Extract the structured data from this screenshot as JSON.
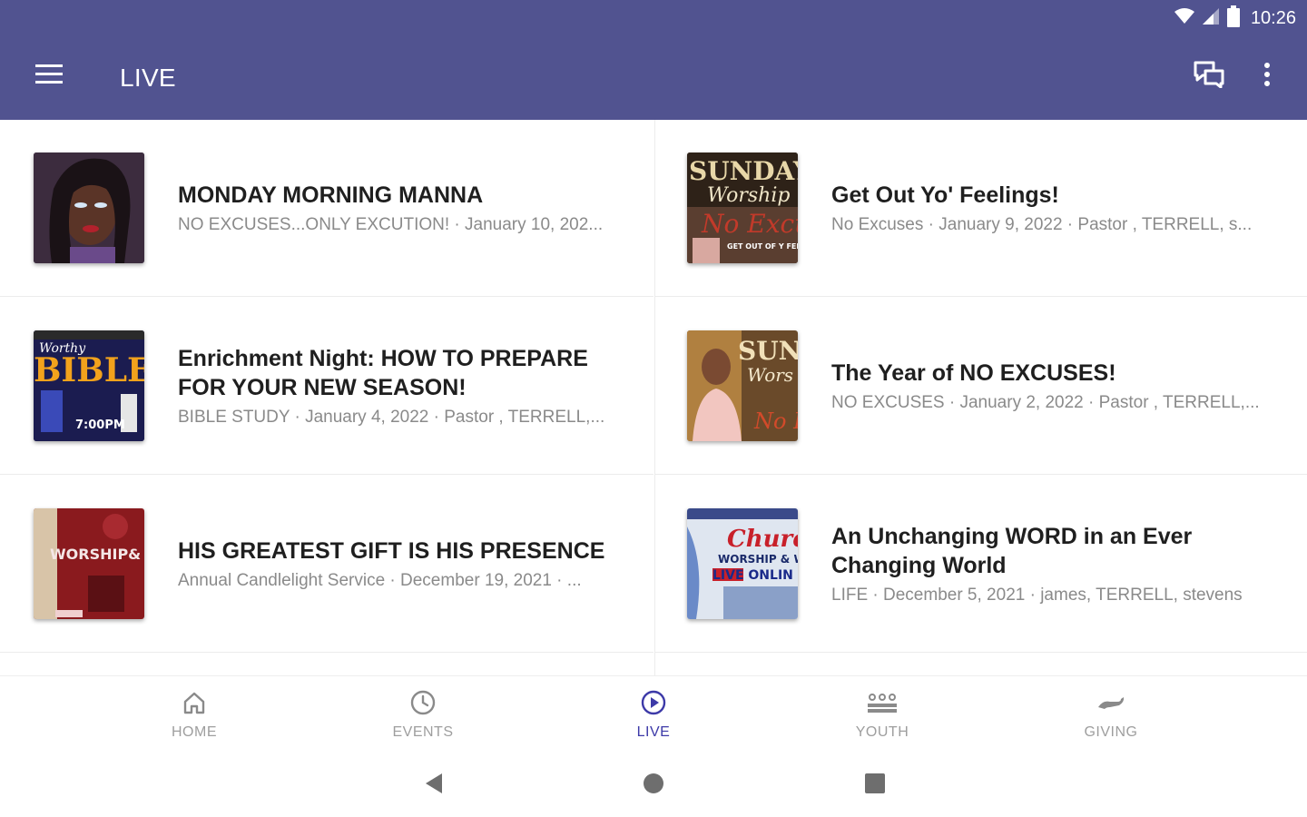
{
  "status_bar": {
    "time": "10:26",
    "icons": [
      "wifi-icon",
      "signal-icon",
      "battery-icon"
    ]
  },
  "app_bar": {
    "title": "LIVE",
    "icons": [
      "menu-icon",
      "chat-icon",
      "more-vert-icon"
    ]
  },
  "items": [
    {
      "title": "MONDAY MORNING MANNA",
      "subtitle": "NO EXCUSES...ONLY EXCUTION! · January 10, 202..."
    },
    {
      "title": "Get Out Yo' Feelings!",
      "subtitle": "No Excuses · January 9, 2022 · Pastor , TERRELL, s..."
    },
    {
      "title": "Enrichment Night: HOW TO PREPARE FOR YOUR NEW SEASON!",
      "subtitle": "BIBLE STUDY · January 4, 2022 · Pastor , TERRELL,..."
    },
    {
      "title": "The Year of NO EXCUSES!",
      "subtitle": "NO EXCUSES · January 2, 2022 · Pastor , TERRELL,..."
    },
    {
      "title": "HIS GREATEST GIFT IS HIS PRESENCE",
      "subtitle": "Annual Candlelight Service · December 19, 2021 · ..."
    },
    {
      "title": "An Unchanging WORD in an Ever Changing World",
      "subtitle": "LIFE · December 5, 2021 · james, TERRELL, stevens"
    }
  ],
  "thumb_text": {
    "sunday": "SUNDAY",
    "worship": "Worship",
    "no_excuses": "No Excu",
    "get_out": "GET OUT OF Y FEELINGS",
    "bible": "BIBLE",
    "worthy": "Worthy",
    "time": "7:00PM",
    "sund": "SUND",
    "wors": "Wors",
    "no_e": "No E",
    "worship_caps": "WORSHIP&",
    "church": "Churc",
    "worship_wo": "WORSHIP & WO",
    "live_online": "LIVE ONLIN"
  },
  "bottom_nav": [
    {
      "label": "HOME",
      "icon": "home-icon",
      "active": false
    },
    {
      "label": "EVENTS",
      "icon": "clock-icon",
      "active": false
    },
    {
      "label": "LIVE",
      "icon": "play-circle-icon",
      "active": true
    },
    {
      "label": "YOUTH",
      "icon": "group-icon",
      "active": false
    },
    {
      "label": "GIVING",
      "icon": "giving-hand-icon",
      "active": false
    }
  ],
  "system_nav": [
    "back-icon",
    "home-circle-icon",
    "recents-icon"
  ],
  "colors": {
    "primary": "#515390",
    "active_tab": "#3d3aa8",
    "inactive_tab": "#9e9e9e"
  }
}
